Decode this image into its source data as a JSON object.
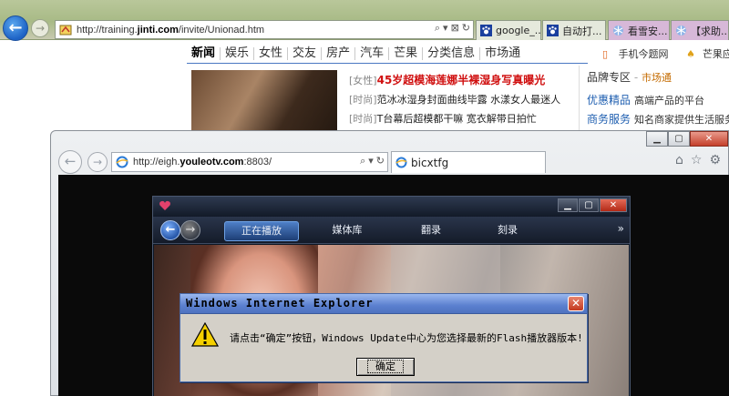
{
  "bg_browser": {
    "url_prefix": "http://training.",
    "url_domain": "jinti.com",
    "url_path": "/invite/Unionad.htm",
    "addr_tools": [
      "⌕",
      "▾",
      "⊠",
      "↻"
    ],
    "tabs": [
      {
        "label": "google_..."
      },
      {
        "label": "自动打..."
      },
      {
        "label": "看雪安..."
      },
      {
        "label": "【求助..."
      }
    ]
  },
  "bg_page": {
    "nav": [
      "新闻",
      "娱乐",
      "女性",
      "交友",
      "房产",
      "汽车",
      "芒果",
      "分类信息",
      "市场通"
    ],
    "right_links": [
      "手机今题网",
      "芒果应用下载"
    ],
    "headlines": [
      {
        "tag": "[女性]",
        "text": "45岁超模海莲娜半裸湿身写真曝光"
      },
      {
        "tag": "[时尚]",
        "text": "范冰冰湿身封面曲线毕露 水漾女人最迷人"
      },
      {
        "tag": "[时尚]",
        "text": "T台幕后超模都干嘛 宽衣解带日拍忙"
      }
    ],
    "brand": {
      "title": "品牌专区",
      "market": "市场通",
      "rows": [
        {
          "highlight": "优惠精品",
          "text": "高端产品的平台"
        },
        {
          "highlight": "商务服务",
          "text": "知名商家提供生活服务"
        }
      ]
    }
  },
  "fg_browser": {
    "url_prefix": "http://eigh.",
    "url_domain": "youleotv.com",
    "url_path": ":8803/",
    "tab_label": "bicxtfg",
    "addr_tools": [
      "⌕",
      "▾",
      "↻"
    ]
  },
  "player": {
    "tabs": [
      "正在播放",
      "媒体库",
      "翻录",
      "刻录"
    ],
    "more": "»"
  },
  "dialog": {
    "title": "Windows Internet Explorer",
    "message": "请点击“确定”按钮，Windows Update中心为您选择最新的Flash播放器版本!",
    "ok_label": "确定"
  }
}
